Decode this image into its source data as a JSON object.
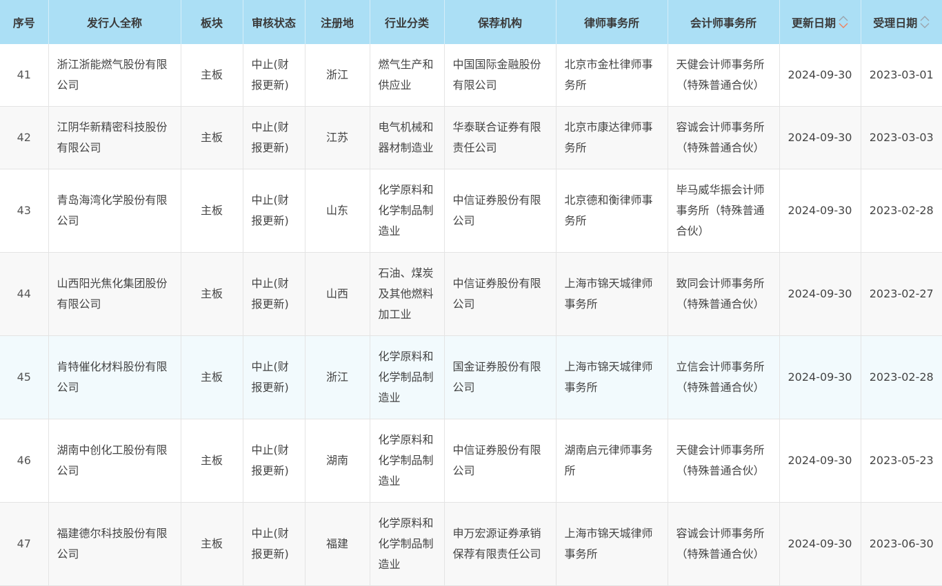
{
  "table": {
    "headers": {
      "index": "序号",
      "issuer": "发行人全称",
      "board": "板块",
      "status": "审核状态",
      "region": "注册地",
      "industry": "行业分类",
      "sponsor": "保荐机构",
      "law_firm": "律师事务所",
      "accounting_firm": "会计师事务所",
      "update_date": "更新日期",
      "accept_date": "受理日期"
    },
    "sort_colors": {
      "active": "#f07f5c",
      "inactive": "#9aa3ab"
    },
    "rows": [
      {
        "index": "41",
        "issuer": "浙江浙能燃气股份有限公司",
        "board": "主板",
        "status": "中止(财报更新)",
        "region": "浙江",
        "industry": "燃气生产和供应业",
        "sponsor": "中国国际金融股份有限公司",
        "law_firm": "北京市金杜律师事务所",
        "accounting_firm": "天健会计师事务所（特殊普通合伙）",
        "update_date": "2024-09-30",
        "accept_date": "2023-03-01"
      },
      {
        "index": "42",
        "issuer": "江阴华新精密科技股份有限公司",
        "board": "主板",
        "status": "中止(财报更新)",
        "region": "江苏",
        "industry": "电气机械和器材制造业",
        "sponsor": "华泰联合证券有限责任公司",
        "law_firm": "北京市康达律师事务所",
        "accounting_firm": "容诚会计师事务所（特殊普通合伙）",
        "update_date": "2024-09-30",
        "accept_date": "2023-03-03"
      },
      {
        "index": "43",
        "issuer": "青岛海湾化学股份有限公司",
        "board": "主板",
        "status": "中止(财报更新)",
        "region": "山东",
        "industry": "化学原料和化学制品制造业",
        "sponsor": "中信证券股份有限公司",
        "law_firm": "北京德和衡律师事务所",
        "accounting_firm": "毕马威华振会计师事务所（特殊普通合伙）",
        "update_date": "2024-09-30",
        "accept_date": "2023-02-28"
      },
      {
        "index": "44",
        "issuer": "山西阳光焦化集团股份有限公司",
        "board": "主板",
        "status": "中止(财报更新)",
        "region": "山西",
        "industry": "石油、煤炭及其他燃料加工业",
        "sponsor": "中信证券股份有限公司",
        "law_firm": "上海市锦天城律师事务所",
        "accounting_firm": "致同会计师事务所（特殊普通合伙）",
        "update_date": "2024-09-30",
        "accept_date": "2023-02-27"
      },
      {
        "index": "45",
        "issuer": "肯特催化材料股份有限公司",
        "board": "主板",
        "status": "中止(财报更新)",
        "region": "浙江",
        "industry": "化学原料和化学制品制造业",
        "sponsor": "国金证券股份有限公司",
        "law_firm": "上海市锦天城律师事务所",
        "accounting_firm": "立信会计师事务所（特殊普通合伙）",
        "update_date": "2024-09-30",
        "accept_date": "2023-02-28"
      },
      {
        "index": "46",
        "issuer": "湖南中创化工股份有限公司",
        "board": "主板",
        "status": "中止(财报更新)",
        "region": "湖南",
        "industry": "化学原料和化学制品制造业",
        "sponsor": "中信证券股份有限公司",
        "law_firm": "湖南启元律师事务所",
        "accounting_firm": "天健会计师事务所（特殊普通合伙）",
        "update_date": "2024-09-30",
        "accept_date": "2023-05-23"
      },
      {
        "index": "47",
        "issuer": "福建德尔科技股份有限公司",
        "board": "主板",
        "status": "中止(财报更新)",
        "region": "福建",
        "industry": "化学原料和化学制品制造业",
        "sponsor": "申万宏源证券承销保荐有限责任公司",
        "law_firm": "上海市锦天城律师事务所",
        "accounting_firm": "容诚会计师事务所（特殊普通合伙）",
        "update_date": "2024-09-30",
        "accept_date": "2023-06-30"
      }
    ]
  }
}
